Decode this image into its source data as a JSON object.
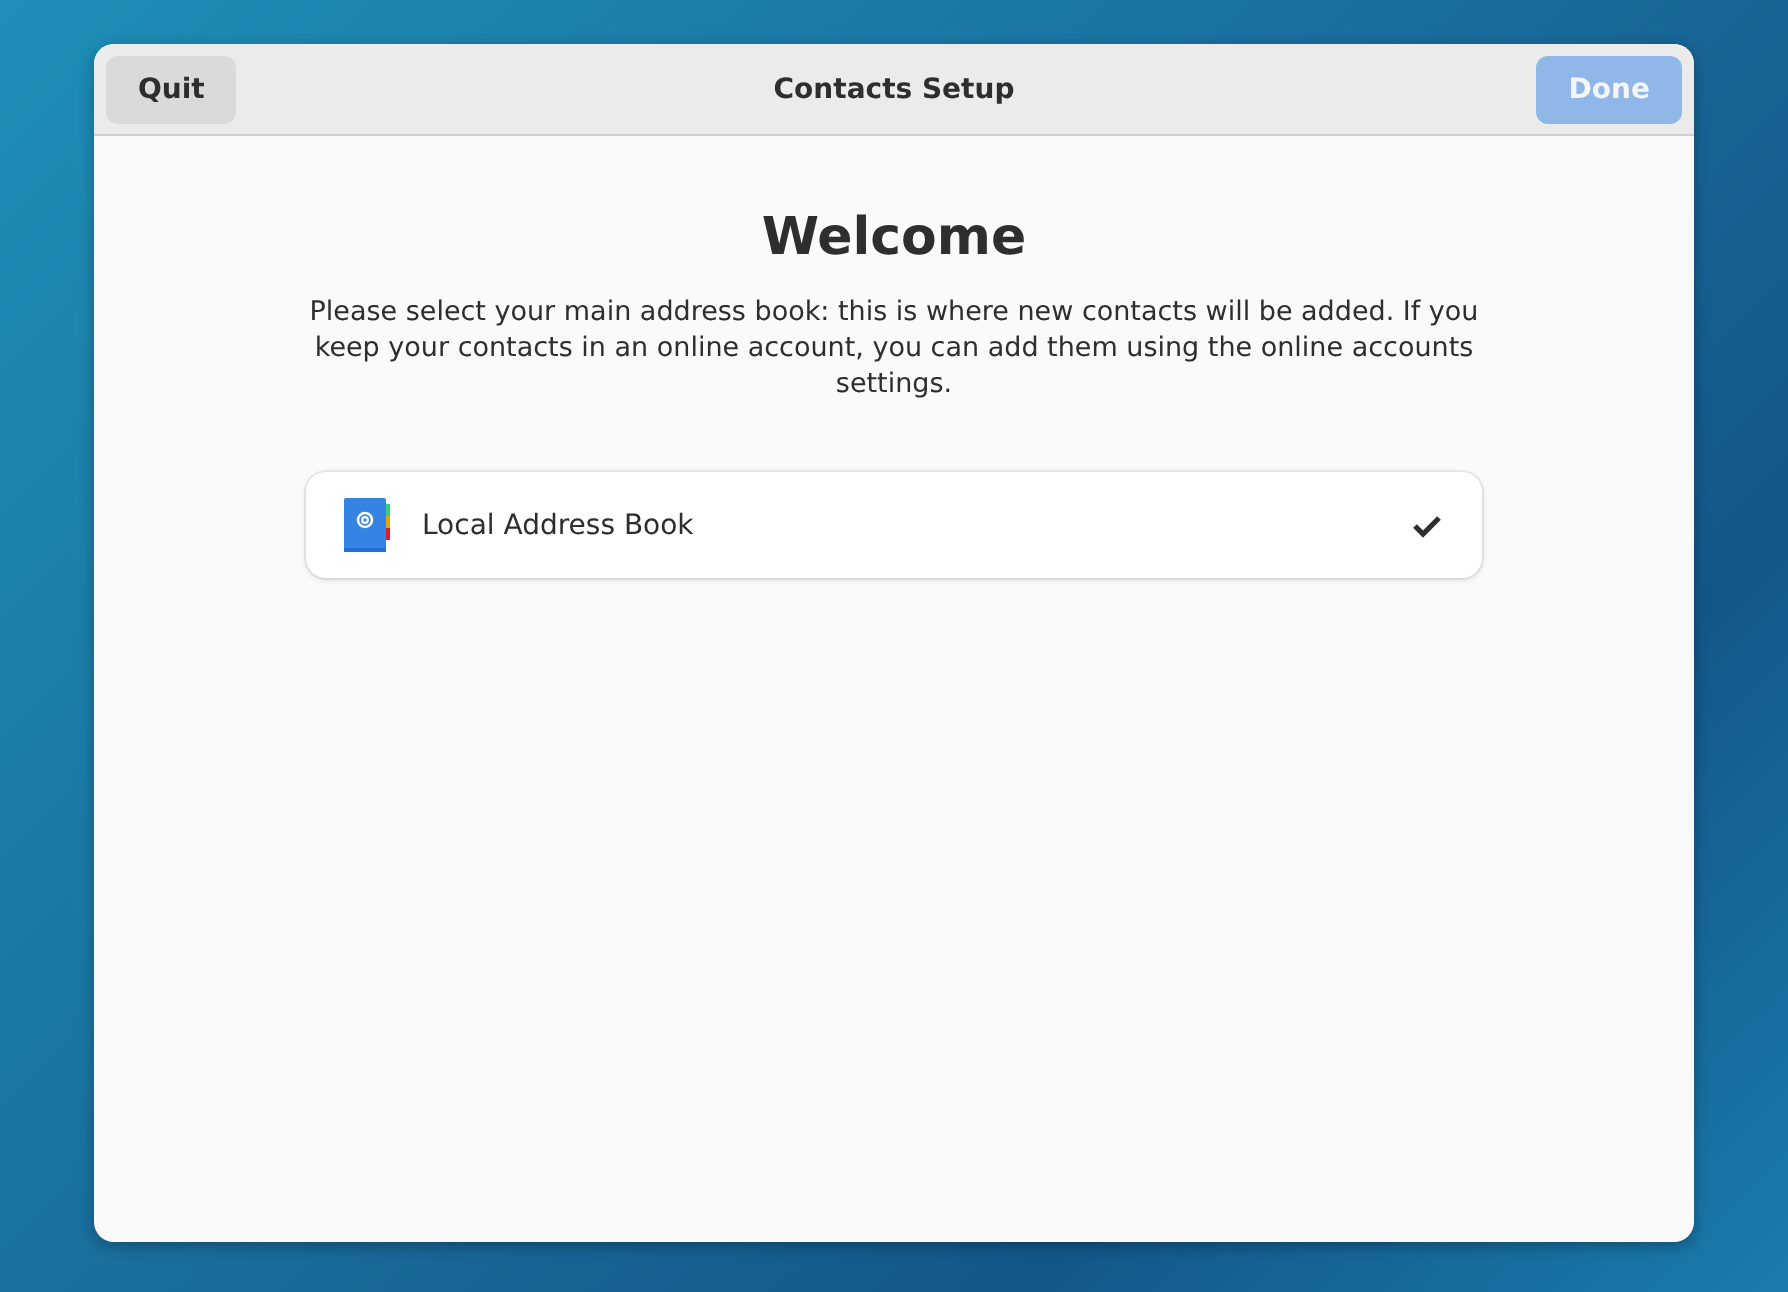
{
  "window": {
    "title": "Contacts Setup"
  },
  "header_buttons": [
    {
      "label": "Quit",
      "kind": "plain",
      "disabled": false
    },
    {
      "label": "Done",
      "kind": "suggested",
      "disabled": true
    }
  ],
  "heading": "Welcome",
  "description": "Please select your main address book: this is where new contacts will be added. If you keep your contacts in an online account, you can add them using the online accounts settings.",
  "address_books": [
    {
      "name": "Local Address Book",
      "selected": true
    }
  ]
}
